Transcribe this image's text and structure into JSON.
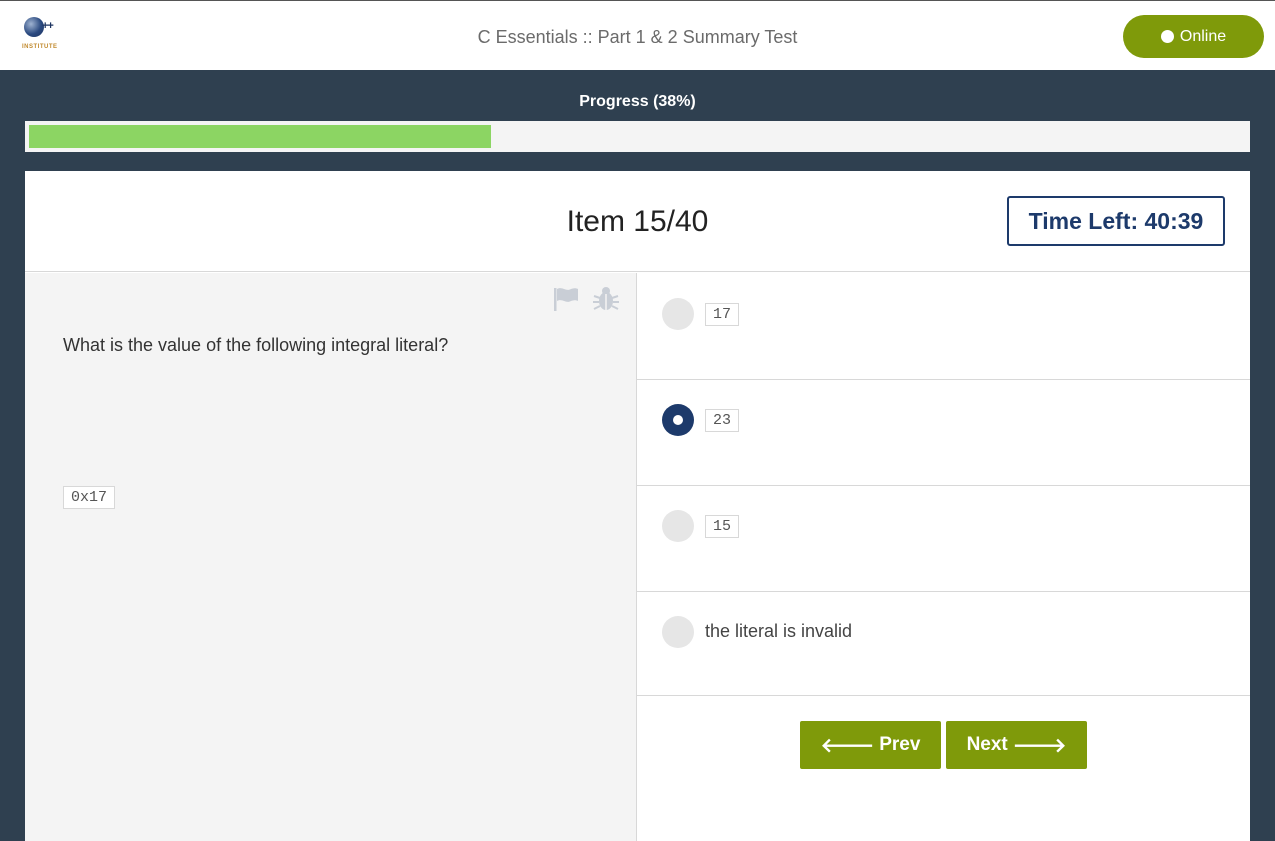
{
  "header": {
    "logo_text": "INSTITUTE",
    "logo_plus": "++",
    "title": "C Essentials :: Part 1 & 2 Summary Test",
    "status_label": "Online"
  },
  "progress": {
    "label": "Progress (38%)",
    "fraction": 0.38
  },
  "item": {
    "title": "Item 15/40",
    "time_left": "Time Left: 40:39"
  },
  "question": {
    "text": "What is the value of the following integral literal?",
    "code": "0x17",
    "icons": [
      "flag-icon",
      "bug-icon"
    ]
  },
  "answers": [
    {
      "label": "17",
      "is_code": true,
      "selected": false
    },
    {
      "label": "23",
      "is_code": true,
      "selected": true
    },
    {
      "label": "15",
      "is_code": true,
      "selected": false
    },
    {
      "label": "the literal is invalid",
      "is_code": false,
      "selected": false
    }
  ],
  "navigation": {
    "prev_label": "Prev",
    "next_label": "Next",
    "prev_arrow": "🡐",
    "next_arrow": "🡒"
  },
  "colors": {
    "accent_green": "#7f9a0a",
    "progress_green": "#8cd563",
    "navy": "#1d3a6b",
    "background": "#2f4050"
  }
}
